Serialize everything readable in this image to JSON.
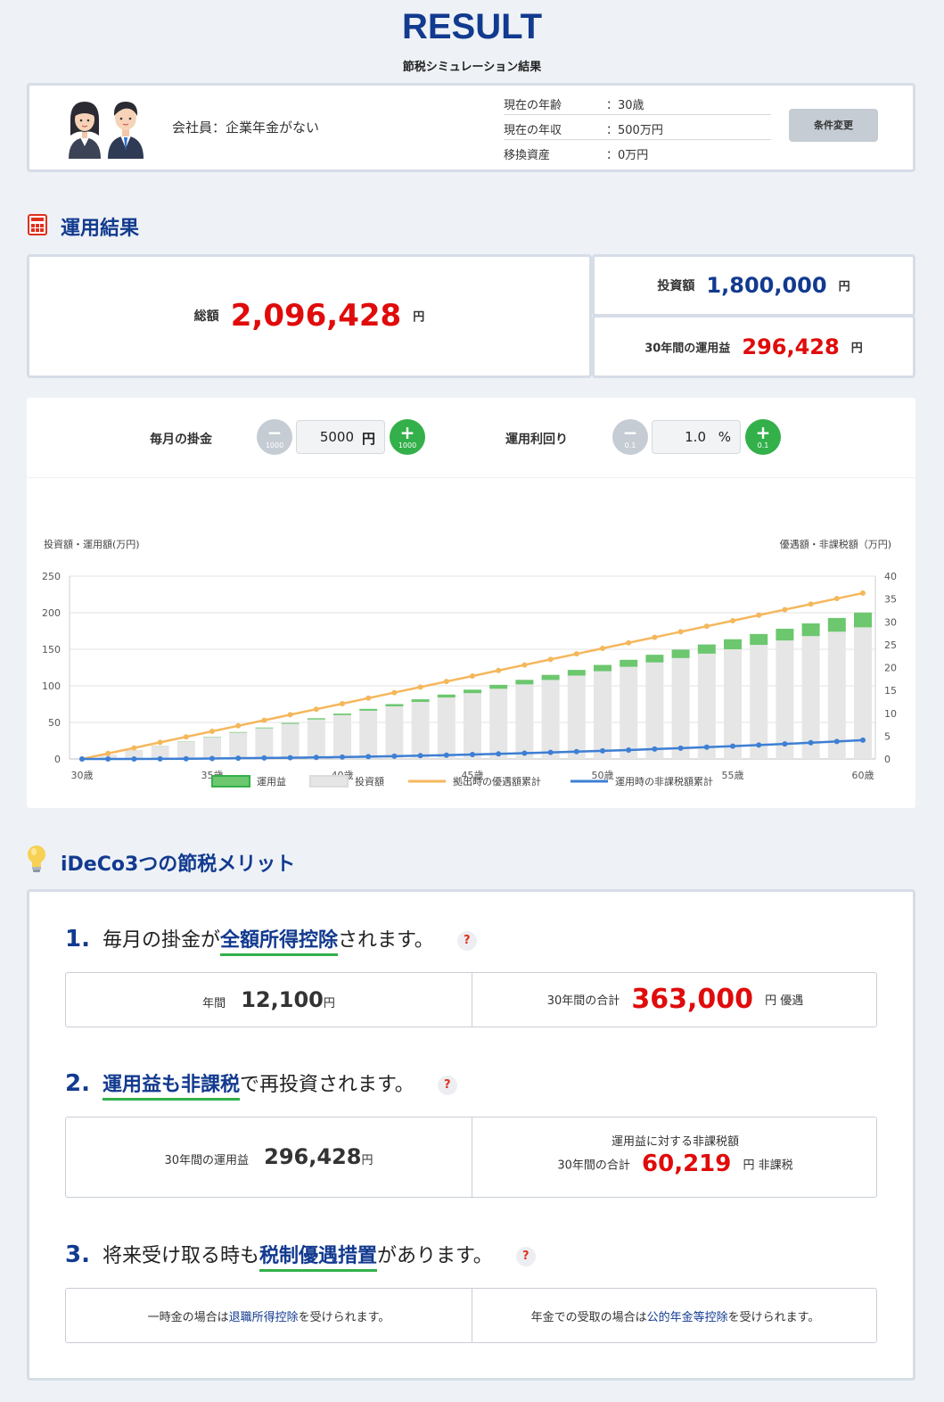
{
  "header": {
    "title": "RESULT",
    "subtitle": "節税シミュレーション結果"
  },
  "profile": {
    "type_label": "会社員：企業年金がない",
    "rows": [
      {
        "label": "現在の年齢",
        "value": "：30歳"
      },
      {
        "label": "現在の年収",
        "value": "：500万円"
      },
      {
        "label": "移換資産",
        "value": "：0万円"
      }
    ],
    "change_button": "条件変更"
  },
  "results": {
    "section_title": "運用結果",
    "total_label": "総額",
    "total_value": "2,096,428",
    "total_unit": "円",
    "invest_label": "投資額",
    "invest_value": "1,800,000",
    "invest_unit": "円",
    "gain_label": "30年間の運用益",
    "gain_value": "296,428",
    "gain_unit": "円"
  },
  "controls": {
    "monthly_label": "毎月の掛金",
    "monthly_value": "5000",
    "monthly_unit": "円",
    "monthly_step": "1000",
    "rate_label": "運用利回り",
    "rate_value": "1.0",
    "rate_unit": "%",
    "rate_step": "0.1",
    "minus_symbol": "−",
    "plus_symbol": "+"
  },
  "chart_data": {
    "type": "bar",
    "left_axis_label": "投資額・運用額(万円)",
    "right_axis_label": "優遇額・非課税額（万円)",
    "left_ticks": [
      "250",
      "200",
      "150",
      "100",
      "50",
      "0"
    ],
    "right_ticks": [
      "40",
      "35",
      "30",
      "25",
      "20",
      "15",
      "10",
      "5",
      "0"
    ],
    "x_labels": [
      "30歳",
      "35歳",
      "40歳",
      "45歳",
      "50歳",
      "55歳",
      "60歳"
    ],
    "x": [
      30,
      31,
      32,
      33,
      34,
      35,
      36,
      37,
      38,
      39,
      40,
      41,
      42,
      43,
      44,
      45,
      46,
      47,
      48,
      49,
      50,
      51,
      52,
      53,
      54,
      55,
      56,
      57,
      58,
      59,
      60
    ],
    "ylim_left": [
      0,
      250
    ],
    "ylim_right": [
      0,
      40
    ],
    "series": [
      {
        "name": "運用益",
        "axis": "left",
        "kind": "bar-stack",
        "color": "#6cc76e",
        "values": [
          0,
          0,
          0.1,
          0.2,
          0.3,
          0.5,
          0.8,
          1.0,
          1.3,
          1.7,
          2.1,
          2.5,
          3.0,
          3.6,
          4.1,
          4.8,
          5.4,
          6.2,
          7.0,
          7.8,
          8.6,
          9.6,
          10.5,
          11.5,
          12.6,
          13.7,
          14.9,
          16.1,
          17.4,
          18.8,
          20.2
        ]
      },
      {
        "name": "投資額",
        "axis": "left",
        "kind": "bar-stack",
        "color": "#e6e6e6",
        "values": [
          0,
          6,
          12,
          18,
          24,
          30,
          36,
          42,
          48,
          54,
          60,
          66,
          72,
          78,
          84,
          90,
          96,
          102,
          108,
          114,
          120,
          126,
          132,
          138,
          144,
          150,
          156,
          162,
          168,
          174,
          180
        ]
      },
      {
        "name": "拠出時の優遇額累計",
        "axis": "right",
        "kind": "line",
        "color": "#f5b75c",
        "values": [
          0,
          1.21,
          2.42,
          3.63,
          4.84,
          6.05,
          7.26,
          8.47,
          9.68,
          10.89,
          12.1,
          13.31,
          14.52,
          15.73,
          16.94,
          18.15,
          19.36,
          20.57,
          21.78,
          22.99,
          24.2,
          25.41,
          26.62,
          27.83,
          29.04,
          30.25,
          31.46,
          32.67,
          33.88,
          35.09,
          36.3
        ]
      },
      {
        "name": "運用時の非課税額累計",
        "axis": "right",
        "kind": "line",
        "color": "#3d7fd4",
        "values": [
          0,
          0,
          0,
          0.02,
          0.06,
          0.1,
          0.16,
          0.22,
          0.28,
          0.35,
          0.42,
          0.51,
          0.61,
          0.72,
          0.84,
          0.97,
          1.11,
          1.26,
          1.43,
          1.6,
          1.78,
          1.96,
          2.16,
          2.36,
          2.58,
          2.81,
          3.05,
          3.3,
          3.56,
          3.84,
          4.12
        ]
      }
    ]
  },
  "merits": {
    "section_title": "iDeCo3つの節税メリット",
    "q": "?",
    "m1": {
      "num": "1.",
      "pre": "毎月の掛金が",
      "hl": "全額所得控除",
      "post": "されます。",
      "left_label": "年間",
      "left_value": "12,100",
      "left_unit": "円",
      "right_label": "30年間の合計",
      "right_value": "363,000",
      "right_unit": "円 優遇"
    },
    "m2": {
      "num": "2.",
      "hl": "運用益も非課税",
      "post": "で再投資されます。",
      "left_label": "30年間の運用益",
      "left_value": "296,428",
      "left_unit": "円",
      "right_top": "運用益に対する非課税額",
      "right_label": "30年間の合計",
      "right_value": "60,219",
      "right_unit": "円 非課税"
    },
    "m3": {
      "num": "3.",
      "pre": "将来受け取る時も",
      "hl": "税制優遇措置",
      "post": "があります。",
      "left_pre": "一時金の場合は",
      "left_link": "退職所得控除",
      "left_post": "を受けられます。",
      "right_pre": "年金での受取の場合は",
      "right_link": "公的年金等控除",
      "right_post": "を受けられます。"
    }
  }
}
